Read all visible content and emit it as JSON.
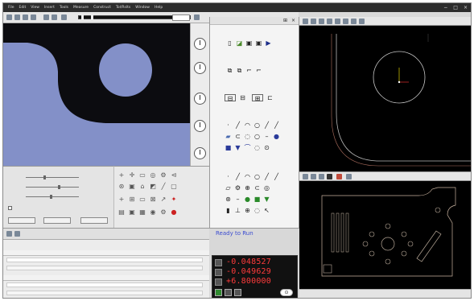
{
  "menu": {
    "items": [
      "File",
      "Edit",
      "View",
      "Insert",
      "Tools",
      "Measure",
      "Construct",
      "Tol/Rslts",
      "Window",
      "Help"
    ]
  },
  "window_controls": {
    "minimize": "−",
    "maximize": "□",
    "close": "×"
  },
  "dro": {
    "status": "Ready to Run",
    "x": "-0.048527",
    "y": "-0.049629",
    "z": "+6.800000"
  },
  "icons": {
    "palette": [
      "point",
      "line",
      "arc",
      "circle",
      "distance",
      "angle",
      "plane",
      "cylinder",
      "cone",
      "sphere"
    ],
    "tools": [
      "crosshair",
      "move",
      "box",
      "circle-tool",
      "gear",
      "edge"
    ]
  },
  "colors": {
    "camera_background": "#8390c8",
    "part_dark": "#0c0c10",
    "dro_digits": "#ff3b3b",
    "cad_background": "#000000",
    "status_text": "#3a4bd0"
  }
}
